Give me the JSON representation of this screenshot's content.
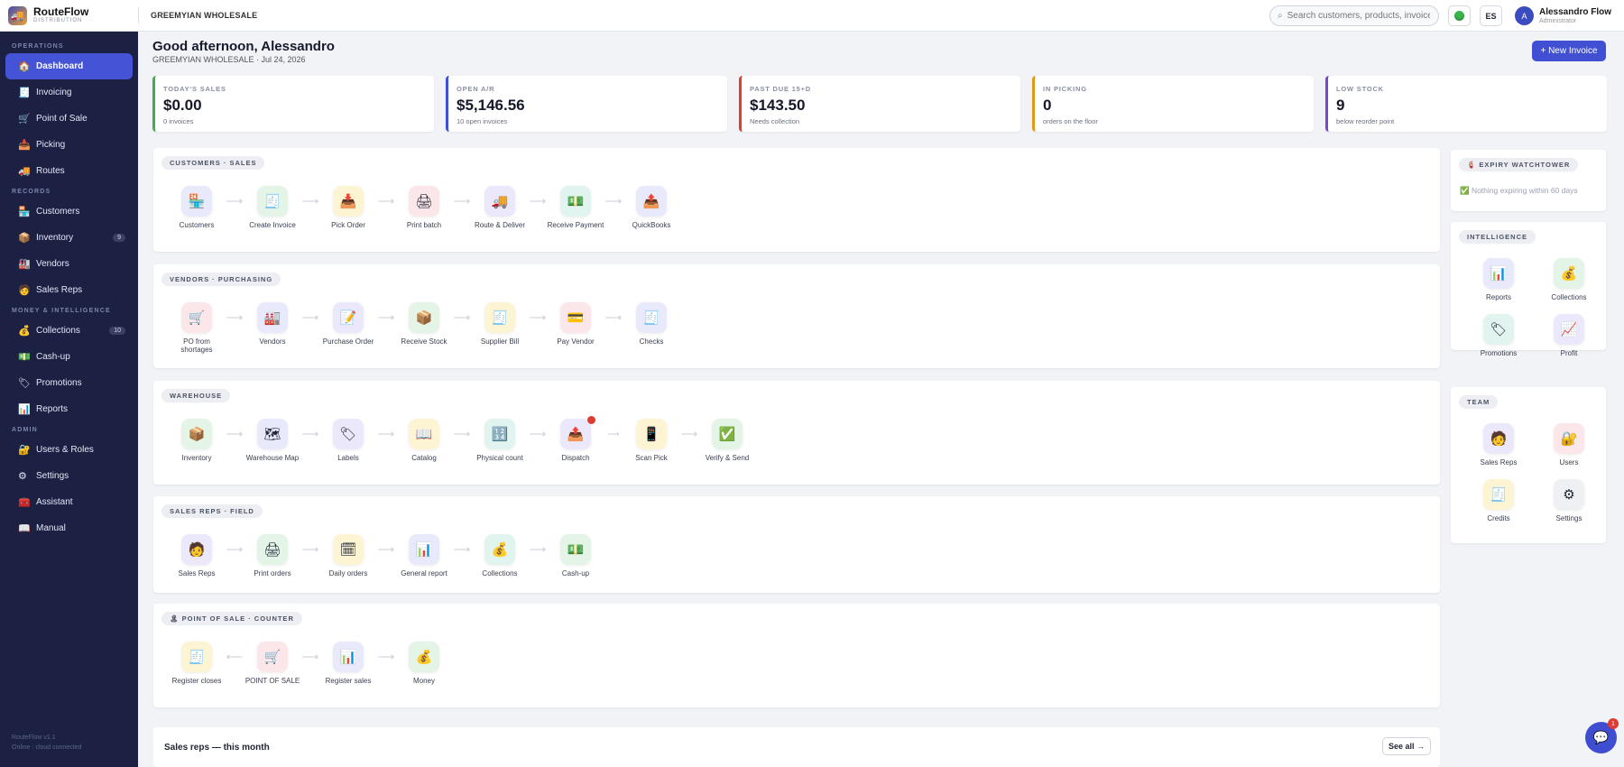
{
  "brand": {
    "name": "RouteFlow",
    "sub": "DISTRIBUTION",
    "icon": "truck-icon"
  },
  "company": "GREEMYIAN WHOLESALE",
  "search": {
    "placeholder": "Search customers, products, invoices"
  },
  "lang": "ES",
  "user": {
    "name": "Alessandro Flow",
    "role": "Administrator",
    "initial": "A"
  },
  "sidebar": {
    "sections": [
      {
        "label": "OPERATIONS",
        "items": [
          {
            "label": "Dashboard",
            "icon": "🏠",
            "active": true
          },
          {
            "label": "Invoicing",
            "icon": "🧾"
          },
          {
            "label": "Point of Sale",
            "icon": "🛒"
          },
          {
            "label": "Picking",
            "icon": "📥"
          },
          {
            "label": "Routes",
            "icon": "🚚"
          }
        ]
      },
      {
        "label": "RECORDS",
        "items": [
          {
            "label": "Customers",
            "icon": "🏪"
          },
          {
            "label": "Inventory",
            "icon": "📦",
            "badge": "9"
          },
          {
            "label": "Vendors",
            "icon": "🏭"
          },
          {
            "label": "Sales Reps",
            "icon": "🧑"
          }
        ]
      },
      {
        "label": "MONEY & INTELLIGENCE",
        "items": [
          {
            "label": "Collections",
            "icon": "💰",
            "badge": "10"
          },
          {
            "label": "Cash-up",
            "icon": "💵"
          },
          {
            "label": "Promotions",
            "icon": "🏷"
          },
          {
            "label": "Reports",
            "icon": "📊"
          }
        ]
      },
      {
        "label": "ADMIN",
        "items": [
          {
            "label": "Users & Roles",
            "icon": "🔐"
          },
          {
            "label": "Settings",
            "icon": "⚙"
          },
          {
            "label": "Assistant",
            "icon": "🧰"
          },
          {
            "label": "Manual",
            "icon": "📖"
          }
        ]
      }
    ],
    "footer1": "RouteFlow v1.1",
    "footer2": "Online · cloud connected"
  },
  "greeting": "Good afternoon, Alessandro",
  "greeting_sub": "GREEMYIAN WHOLESALE · Jul 24, 2026",
  "new_invoice": "+ New Invoice",
  "kpis": [
    {
      "label": "TODAY'S SALES",
      "value": "$0.00",
      "sub": "0 invoices",
      "color": "#3fae4d"
    },
    {
      "label": "OPEN A/R",
      "value": "$5,146.56",
      "sub": "10 open invoices",
      "color": "#4150d2"
    },
    {
      "label": "PAST DUE 15+D",
      "value": "$143.50",
      "sub": "Needs collection",
      "color": "#d9402e"
    },
    {
      "label": "IN PICKING",
      "value": "0",
      "sub": "orders on the floor",
      "color": "#e09a18"
    },
    {
      "label": "LOW STOCK",
      "value": "9",
      "sub": "below reorder point",
      "color": "#7a45d1"
    }
  ],
  "panels": [
    {
      "title": "CUSTOMERS · SALES",
      "steps": [
        {
          "label": "Customers",
          "icon": "🏪",
          "c": "c-blue"
        },
        {
          "label": "Create Invoice",
          "icon": "🧾",
          "c": "c-green"
        },
        {
          "label": "Pick Order",
          "icon": "📥",
          "c": "c-yellow"
        },
        {
          "label": "Print batch",
          "icon": "🖨",
          "c": "c-pink"
        },
        {
          "label": "Route & Deliver",
          "icon": "🚚",
          "c": "c-purple"
        },
        {
          "label": "Receive Payment",
          "icon": "💵",
          "c": "c-teal"
        },
        {
          "label": "QuickBooks",
          "icon": "📤",
          "c": "c-blue"
        }
      ]
    },
    {
      "title": "VENDORS · PURCHASING",
      "steps": [
        {
          "label": "PO from shortages",
          "icon": "🛒",
          "c": "c-pink"
        },
        {
          "label": "Vendors",
          "icon": "🏭",
          "c": "c-blue"
        },
        {
          "label": "Purchase Order",
          "icon": "📝",
          "c": "c-purple"
        },
        {
          "label": "Receive Stock",
          "icon": "📦",
          "c": "c-green"
        },
        {
          "label": "Supplier Bill",
          "icon": "🧾",
          "c": "c-yellow"
        },
        {
          "label": "Pay Vendor",
          "icon": "💳",
          "c": "c-pink"
        },
        {
          "label": "Checks",
          "icon": "🧾",
          "c": "c-blue"
        }
      ]
    },
    {
      "title": "WAREHOUSE",
      "steps": [
        {
          "label": "Inventory",
          "icon": "📦",
          "c": "c-green"
        },
        {
          "label": "Warehouse Map",
          "icon": "🗺",
          "c": "c-blue"
        },
        {
          "label": "Labels",
          "icon": "🏷",
          "c": "c-purple"
        },
        {
          "label": "Catalog",
          "icon": "📖",
          "c": "c-yellow"
        },
        {
          "label": "Physical count",
          "icon": "🔢",
          "c": "c-teal"
        },
        {
          "label": "Dispatch",
          "icon": "📤",
          "c": "c-purple",
          "dot": true
        },
        {
          "label": "Scan Pick",
          "icon": "📱",
          "c": "c-yellow",
          "smallarrow": true
        },
        {
          "label": "Verify & Send",
          "icon": "✅",
          "c": "c-green"
        }
      ]
    },
    {
      "title": "SALES REPS · FIELD",
      "steps": [
        {
          "label": "Sales Reps",
          "icon": "🧑",
          "c": "c-purple"
        },
        {
          "label": "Print orders",
          "icon": "🖨",
          "c": "c-green"
        },
        {
          "label": "Daily orders",
          "icon": "🗓",
          "c": "c-yellow"
        },
        {
          "label": "General report",
          "icon": "📊",
          "c": "c-blue"
        },
        {
          "label": "Collections",
          "icon": "💰",
          "c": "c-teal"
        },
        {
          "label": "Cash-up",
          "icon": "💵",
          "c": "c-green"
        }
      ]
    },
    {
      "title": "🏝 POINT OF SALE · COUNTER",
      "steps": [
        {
          "label": "Register closes",
          "icon": "🧾",
          "c": "c-yellow"
        },
        {
          "label": "POINT OF SALE",
          "icon": "🛒",
          "c": "c-pink",
          "leftarrow": true
        },
        {
          "label": "Register sales",
          "icon": "📊",
          "c": "c-blue"
        },
        {
          "label": "Money",
          "icon": "💰",
          "c": "c-green"
        }
      ]
    }
  ],
  "expiry": {
    "title": "🧯 EXPIRY WATCHTOWER",
    "text": "✅ Nothing expiring within 60 days"
  },
  "intelligence": {
    "title": "INTELLIGENCE",
    "items": [
      {
        "label": "Reports",
        "icon": "📊",
        "c": "c-blue"
      },
      {
        "label": "Collections",
        "icon": "💰",
        "c": "c-green"
      },
      {
        "label": "Promotions",
        "icon": "🏷",
        "c": "c-teal"
      },
      {
        "label": "Profit",
        "icon": "📈",
        "c": "c-purple"
      }
    ]
  },
  "team": {
    "title": "TEAM",
    "items": [
      {
        "label": "Sales Reps",
        "icon": "🧑",
        "c": "c-purple"
      },
      {
        "label": "Users",
        "icon": "🔐",
        "c": "c-pink"
      },
      {
        "label": "Credits",
        "icon": "🧾",
        "c": "c-yellow"
      },
      {
        "label": "Settings",
        "icon": "⚙",
        "c": "c-gray"
      }
    ]
  },
  "bottom": {
    "title": "Sales reps — this month",
    "see_all": "See all →"
  },
  "chat": {
    "badge": "1"
  }
}
